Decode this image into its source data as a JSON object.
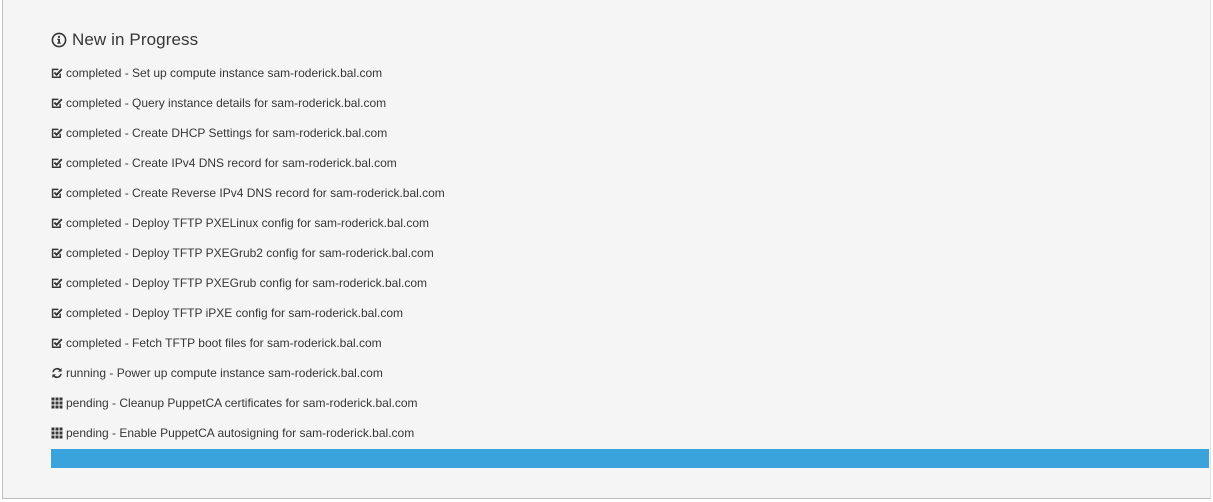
{
  "header": {
    "title": "New in Progress",
    "icon": "info-circle-icon"
  },
  "tasks": [
    {
      "status": "completed",
      "text": "completed - Set up compute instance sam-roderick.bal.com",
      "icon": "check-square-icon"
    },
    {
      "status": "completed",
      "text": "completed - Query instance details for sam-roderick.bal.com",
      "icon": "check-square-icon"
    },
    {
      "status": "completed",
      "text": "completed - Create DHCP Settings for sam-roderick.bal.com",
      "icon": "check-square-icon"
    },
    {
      "status": "completed",
      "text": "completed - Create IPv4 DNS record for sam-roderick.bal.com",
      "icon": "check-square-icon"
    },
    {
      "status": "completed",
      "text": "completed - Create Reverse IPv4 DNS record for sam-roderick.bal.com",
      "icon": "check-square-icon"
    },
    {
      "status": "completed",
      "text": "completed - Deploy TFTP PXELinux config for sam-roderick.bal.com",
      "icon": "check-square-icon"
    },
    {
      "status": "completed",
      "text": "completed - Deploy TFTP PXEGrub2 config for sam-roderick.bal.com",
      "icon": "check-square-icon"
    },
    {
      "status": "completed",
      "text": "completed - Deploy TFTP PXEGrub config for sam-roderick.bal.com",
      "icon": "check-square-icon"
    },
    {
      "status": "completed",
      "text": "completed - Deploy TFTP iPXE config for sam-roderick.bal.com",
      "icon": "check-square-icon"
    },
    {
      "status": "completed",
      "text": "completed - Fetch TFTP boot files for sam-roderick.bal.com",
      "icon": "check-square-icon"
    },
    {
      "status": "running",
      "text": "running - Power up compute instance sam-roderick.bal.com",
      "icon": "refresh-icon"
    },
    {
      "status": "pending",
      "text": "pending - Cleanup PuppetCA certificates for sam-roderick.bal.com",
      "icon": "grid-icon"
    },
    {
      "status": "pending",
      "text": "pending - Enable PuppetCA autosigning for sam-roderick.bal.com",
      "icon": "grid-icon"
    }
  ],
  "progress": {
    "fraction": 1.0,
    "color": "#3ba3db"
  },
  "colors": {
    "text": "#363636",
    "panel_background": "#f5f5f5"
  }
}
